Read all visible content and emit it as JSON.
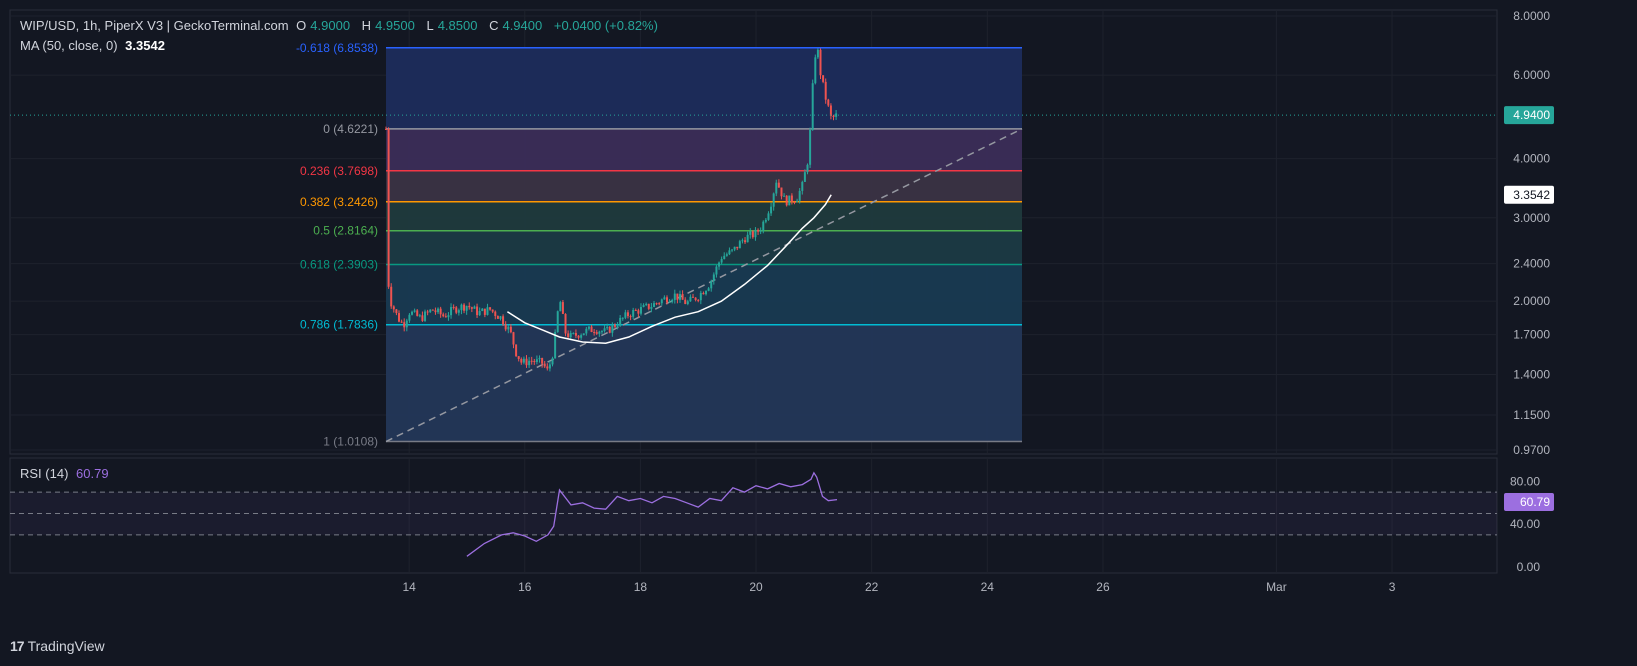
{
  "header": {
    "symbol": "WIP/USD, 1h, PiperX V3 | GeckoTerminal.com",
    "open_label": "O",
    "open": "4.9000",
    "high_label": "H",
    "high": "4.9500",
    "low_label": "L",
    "low": "4.8500",
    "close_label": "C",
    "close": "4.9400",
    "change": "+0.0400 (+0.82%)"
  },
  "ma_legend": {
    "label": "MA (50, close, 0)",
    "value": "3.3542"
  },
  "rsi_legend": {
    "label": "RSI (14)",
    "value": "60.79"
  },
  "branding": {
    "logo": "17",
    "name": "TradingView"
  },
  "colors": {
    "background": "#131722",
    "up": "#26a69a",
    "down": "#ef5350",
    "ma": "#ffffff",
    "rsi": "#9c6fe0",
    "price_tag": "#26a69a"
  },
  "chart_data": [
    {
      "type": "candlestick",
      "title": "WIP/USD, 1h, PiperX V3 | GeckoTerminal.com",
      "y_scale": "log",
      "ylim": [
        0.97,
        8.0
      ],
      "y_ticks": [
        "8.0000",
        "6.0000",
        "4.0000",
        "3.0000",
        "2.4000",
        "2.0000",
        "1.7000",
        "1.4000",
        "1.1500",
        "0.9700"
      ],
      "x_ticks": [
        "14",
        "16",
        "18",
        "20",
        "22",
        "24",
        "26",
        "Mar",
        "3"
      ],
      "x_tick_days": [
        14,
        16,
        18,
        20,
        22,
        24,
        26,
        29,
        31
      ],
      "xlim_days": [
        13.0,
        33.0
      ],
      "last_price": {
        "value": 4.94,
        "label": "4.9400"
      },
      "ma_last": {
        "value": 3.3542,
        "label": "3.3542"
      },
      "price_path": [
        [
          13.6,
          4.62
        ],
        [
          13.62,
          2.3
        ],
        [
          13.68,
          2.0
        ],
        [
          13.8,
          1.85
        ],
        [
          13.9,
          1.78
        ],
        [
          14.0,
          1.9
        ],
        [
          14.2,
          1.84
        ],
        [
          14.4,
          1.92
        ],
        [
          14.6,
          1.86
        ],
        [
          14.8,
          1.93
        ],
        [
          15.0,
          1.96
        ],
        [
          15.2,
          1.89
        ],
        [
          15.4,
          1.92
        ],
        [
          15.6,
          1.84
        ],
        [
          15.75,
          1.72
        ],
        [
          15.85,
          1.56
        ],
        [
          15.95,
          1.48
        ],
        [
          16.1,
          1.5
        ],
        [
          16.3,
          1.48
        ],
        [
          16.4,
          1.42
        ],
        [
          16.5,
          1.58
        ],
        [
          16.6,
          2.04
        ],
        [
          16.7,
          1.72
        ],
        [
          16.8,
          1.68
        ],
        [
          17.0,
          1.72
        ],
        [
          17.2,
          1.75
        ],
        [
          17.4,
          1.72
        ],
        [
          17.6,
          1.8
        ],
        [
          17.8,
          1.88
        ],
        [
          18.0,
          1.92
        ],
        [
          18.2,
          1.96
        ],
        [
          18.4,
          2.02
        ],
        [
          18.6,
          2.06
        ],
        [
          18.8,
          1.98
        ],
        [
          19.0,
          2.05
        ],
        [
          19.2,
          2.18
        ],
        [
          19.4,
          2.48
        ],
        [
          19.6,
          2.55
        ],
        [
          19.8,
          2.72
        ],
        [
          20.0,
          2.78
        ],
        [
          20.1,
          2.88
        ],
        [
          20.25,
          3.2
        ],
        [
          20.35,
          3.6
        ],
        [
          20.5,
          3.25
        ],
        [
          20.7,
          3.3
        ],
        [
          20.8,
          3.5
        ],
        [
          20.9,
          4.0
        ],
        [
          20.95,
          4.8
        ],
        [
          21.0,
          6.3
        ],
        [
          21.05,
          7.0
        ],
        [
          21.12,
          6.0
        ],
        [
          21.2,
          5.4
        ],
        [
          21.3,
          4.85
        ],
        [
          21.4,
          4.94
        ]
      ],
      "ma_path": [
        [
          15.7,
          1.9
        ],
        [
          16.0,
          1.8
        ],
        [
          16.3,
          1.74
        ],
        [
          16.6,
          1.68
        ],
        [
          17.0,
          1.64
        ],
        [
          17.4,
          1.63
        ],
        [
          17.8,
          1.68
        ],
        [
          18.2,
          1.77
        ],
        [
          18.6,
          1.85
        ],
        [
          19.0,
          1.9
        ],
        [
          19.4,
          2.0
        ],
        [
          19.8,
          2.17
        ],
        [
          20.2,
          2.38
        ],
        [
          20.5,
          2.6
        ],
        [
          20.8,
          2.85
        ],
        [
          21.0,
          3.0
        ],
        [
          21.2,
          3.2
        ],
        [
          21.3,
          3.3542
        ]
      ],
      "trendline": {
        "from": [
          13.6,
          1.0108
        ],
        "to": [
          24.6,
          4.6221
        ]
      }
    },
    {
      "type": "fibonacci_retracement",
      "x_range_days": [
        13.6,
        24.6
      ],
      "levels": [
        {
          "ratio": "-0.618",
          "price": 6.8538,
          "label": "-0.618 (6.8538)",
          "color": "#2962ff",
          "fill": "#1c2c5c"
        },
        {
          "ratio": "0",
          "price": 4.6221,
          "label": "0 (4.6221)",
          "color": "#9598a1",
          "fill": "#3b2d58"
        },
        {
          "ratio": "0.236",
          "price": 3.7698,
          "label": "0.236 (3.7698)",
          "color": "#f23645",
          "fill": "#3a3344"
        },
        {
          "ratio": "0.382",
          "price": 3.2426,
          "label": "0.382 (3.2426)",
          "color": "#ff9800",
          "fill": "#1f3a3d"
        },
        {
          "ratio": "0.5",
          "price": 2.8164,
          "label": "0.5 (2.8164)",
          "color": "#4caf50",
          "fill": "#1b3a44"
        },
        {
          "ratio": "0.618",
          "price": 2.3903,
          "label": "0.618 (2.3903)",
          "color": "#089981",
          "fill": "#183a52"
        },
        {
          "ratio": "0.786",
          "price": 1.7836,
          "label": "0.786 (1.7836)",
          "color": "#00bcd4",
          "fill": "#233758"
        },
        {
          "ratio": "1",
          "price": 1.0108,
          "label": "1 (1.0108)",
          "color": "#787b86",
          "fill": "#233758"
        }
      ]
    },
    {
      "type": "line",
      "name": "RSI (14)",
      "ylim": [
        0,
        100
      ],
      "y_ticks": [
        "80.00",
        "40.00",
        "0.00"
      ],
      "bands": [
        70,
        50,
        30
      ],
      "last": {
        "value": 60.79,
        "label": "60.79"
      },
      "x": [
        15.0,
        15.3,
        15.6,
        15.8,
        16.0,
        16.2,
        16.4,
        16.5,
        16.55,
        16.6,
        16.8,
        17.0,
        17.2,
        17.4,
        17.6,
        17.8,
        18.0,
        18.2,
        18.4,
        18.6,
        18.8,
        19.0,
        19.2,
        19.4,
        19.6,
        19.8,
        20.0,
        20.2,
        20.4,
        20.6,
        20.8,
        20.95,
        21.0,
        21.05,
        21.15,
        21.25,
        21.4
      ],
      "values": [
        10,
        22,
        30,
        32,
        29,
        24,
        30,
        38,
        55,
        72,
        58,
        60,
        55,
        54,
        66,
        62,
        64,
        60,
        66,
        64,
        60,
        56,
        64,
        62,
        74,
        70,
        76,
        73,
        78,
        75,
        77,
        82,
        88,
        84,
        66,
        62,
        63
      ]
    }
  ]
}
